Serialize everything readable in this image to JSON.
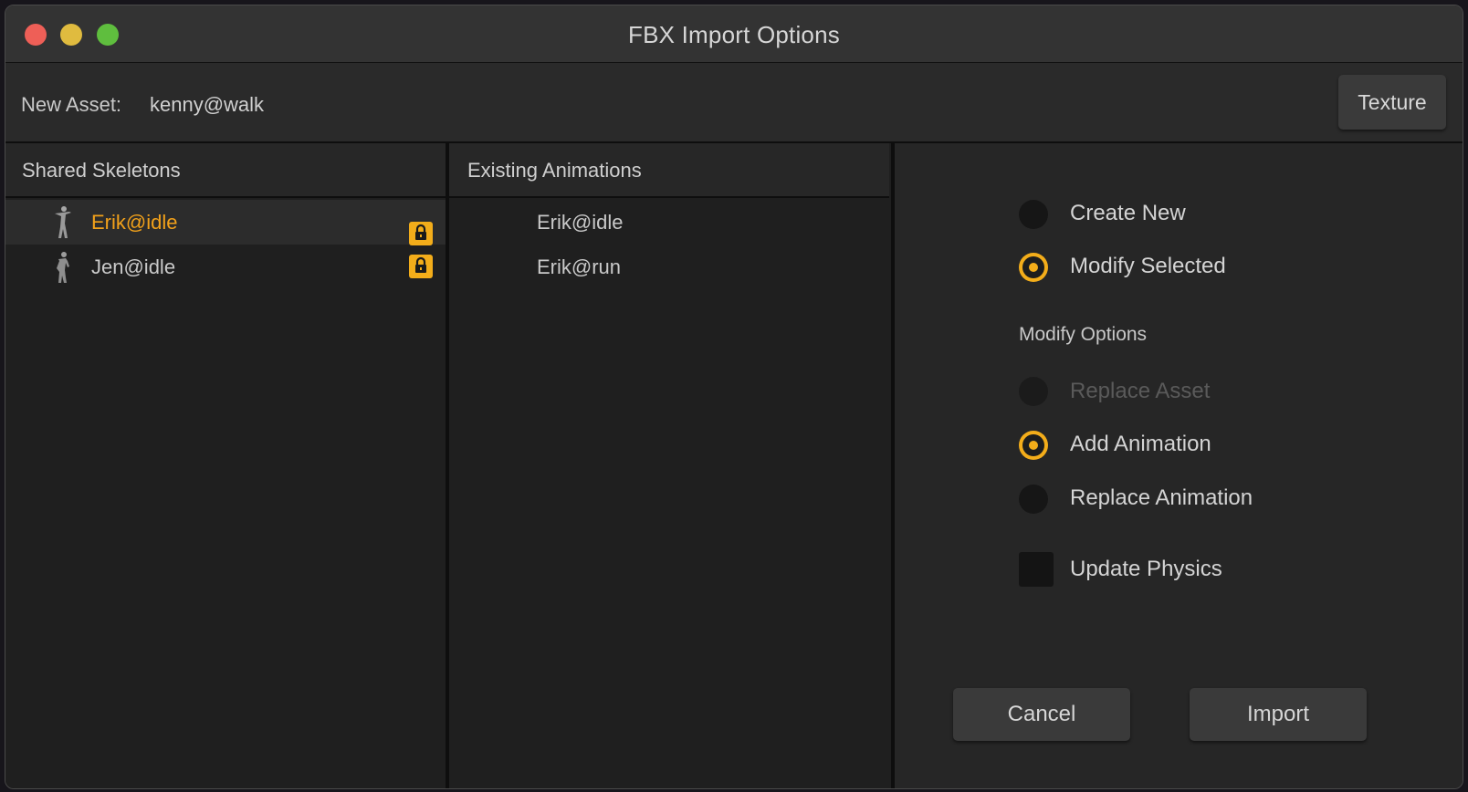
{
  "window": {
    "title": "FBX Import Options"
  },
  "header": {
    "asset_label": "New Asset:",
    "asset_value": "kenny@walk",
    "texture_button": "Texture"
  },
  "left_panel": {
    "title": "Shared Skeletons",
    "items": [
      {
        "label": "Erik@idle",
        "selected": true,
        "locked": true
      },
      {
        "label": "Jen@idle",
        "selected": false,
        "locked": true
      }
    ]
  },
  "middle_panel": {
    "title": "Existing Animations",
    "items": [
      {
        "label": "Erik@idle"
      },
      {
        "label": "Erik@run"
      }
    ]
  },
  "right_panel": {
    "mode_options": [
      {
        "label": "Create New",
        "checked": false
      },
      {
        "label": "Modify Selected",
        "checked": true
      }
    ],
    "modify_options_title": "Modify Options",
    "modify_options": [
      {
        "label": "Replace Asset",
        "checked": false,
        "disabled": true
      },
      {
        "label": "Add Animation",
        "checked": true,
        "disabled": false
      },
      {
        "label": "Replace Animation",
        "checked": false,
        "disabled": false
      }
    ],
    "update_physics": {
      "label": "Update Physics",
      "checked": false
    },
    "cancel_button": "Cancel",
    "import_button": "Import"
  },
  "colors": {
    "accent": "#f3ad1a",
    "selected_text": "#f2a11a"
  }
}
